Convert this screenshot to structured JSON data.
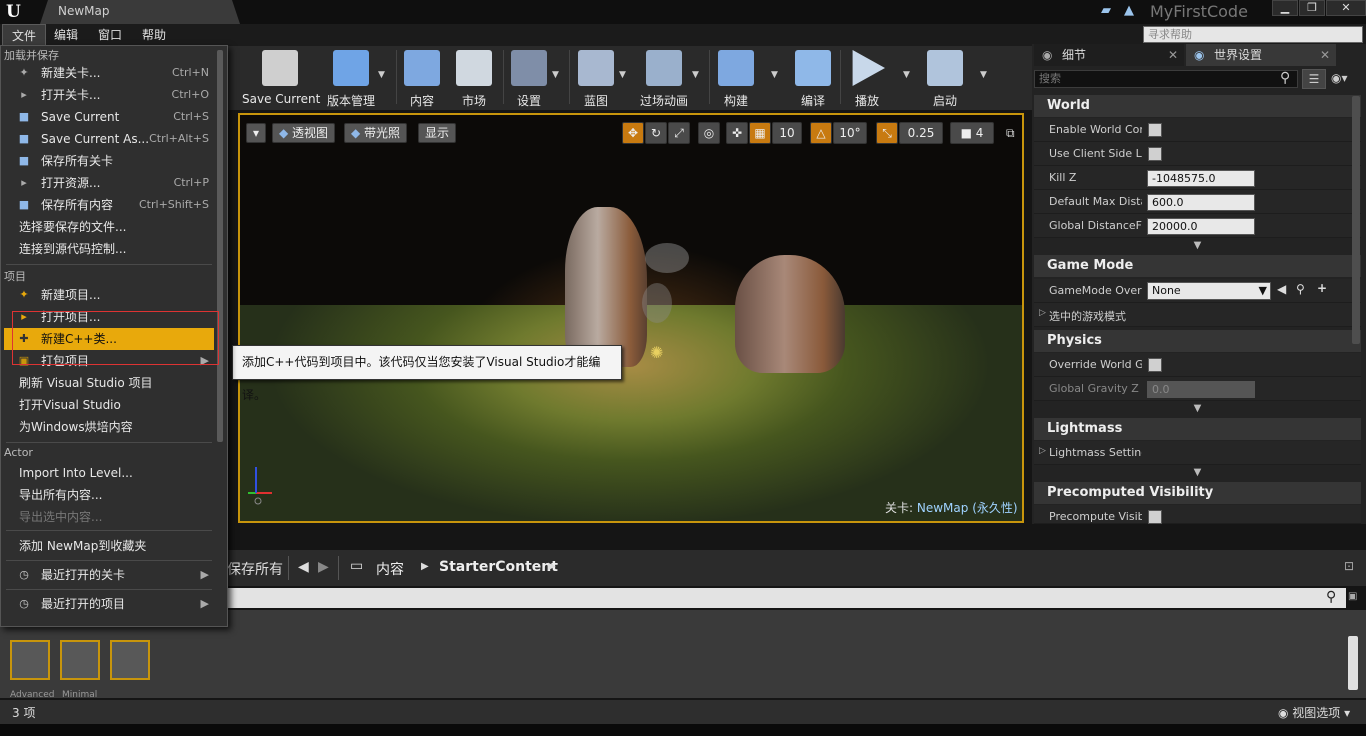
{
  "titlebar": {
    "tab": "NewMap",
    "project": "MyFirstCode",
    "search_placeholder": "寻求帮助"
  },
  "menubar": [
    "文件",
    "编辑",
    "窗口",
    "帮助"
  ],
  "toolbar": [
    {
      "label": "Save Current",
      "icon": "save-icon",
      "color": "#d8d8d8"
    },
    {
      "label": "版本管理",
      "icon": "source-control-icon",
      "color": "#6fa4e6"
    },
    {
      "label": "内容",
      "icon": "content-icon",
      "color": "#7ea8e0"
    },
    {
      "label": "市场",
      "icon": "marketplace-icon",
      "color": "#d0d8e0"
    },
    {
      "label": "设置",
      "icon": "settings-icon",
      "color": "#7f8ea8"
    },
    {
      "label": "蓝图",
      "icon": "blueprint-icon",
      "color": "#a8b8d0"
    },
    {
      "label": "过场动画",
      "icon": "cinematics-icon",
      "color": "#9ab0cc"
    },
    {
      "label": "构建",
      "icon": "build-icon",
      "color": "#7ea8e0"
    },
    {
      "label": "编译",
      "icon": "compile-icon",
      "color": "#8fb8e8"
    },
    {
      "label": "播放",
      "icon": "play-icon",
      "color": "#c8d8ea"
    },
    {
      "label": "启动",
      "icon": "launch-icon",
      "color": "#b0c4dc"
    }
  ],
  "viewport": {
    "buttons": [
      "透视图",
      "带光照",
      "显示"
    ],
    "grid_snap": "10",
    "rot_snap": "10°",
    "scale_snap": "0.25",
    "cam_speed": "4",
    "level_prefix": "关卡:",
    "level_name": "NewMap (永久性)"
  },
  "tooltip": "添加C++代码到项目中。该代码仅当您安装了Visual Studio才能编译。",
  "file_menu": {
    "sections": [
      {
        "header": "加载并保存",
        "items": [
          {
            "label": "新建关卡...",
            "shortcut": "Ctrl+N",
            "icon": "new-level-icon"
          },
          {
            "label": "打开关卡...",
            "shortcut": "Ctrl+O",
            "icon": "open-level-icon"
          },
          {
            "label": "Save Current",
            "shortcut": "Ctrl+S",
            "icon": "save-icon"
          },
          {
            "label": "Save Current As...",
            "shortcut": "Ctrl+Alt+S",
            "icon": "save-as-icon"
          },
          {
            "label": "保存所有关卡",
            "shortcut": "",
            "icon": "save-all-levels-icon"
          },
          {
            "label": "打开资源...",
            "shortcut": "Ctrl+P",
            "icon": "open-asset-icon"
          },
          {
            "label": "保存所有内容",
            "shortcut": "Ctrl+Shift+S",
            "icon": "save-all-icon"
          },
          {
            "label": "选择要保存的文件...",
            "shortcut": "",
            "icon": ""
          },
          {
            "label": "连接到源代码控制...",
            "shortcut": "",
            "icon": ""
          }
        ]
      },
      {
        "header": "项目",
        "items": [
          {
            "label": "新建项目...",
            "shortcut": "",
            "icon": "new-project-icon"
          },
          {
            "label": "打开项目...",
            "shortcut": "",
            "icon": "open-project-icon"
          },
          {
            "label": "新建C++类...",
            "shortcut": "",
            "icon": "new-cpp-class-icon"
          },
          {
            "label": "打包项目",
            "shortcut": "",
            "icon": "package-project-icon"
          },
          {
            "label": "刷新 Visual Studio 项目",
            "shortcut": "",
            "icon": ""
          },
          {
            "label": "打开Visual Studio",
            "shortcut": "",
            "icon": ""
          },
          {
            "label": "为Windows烘培内容",
            "shortcut": "",
            "icon": ""
          }
        ]
      },
      {
        "header": "Actor",
        "items": [
          {
            "label": "Import Into Level...",
            "shortcut": "",
            "icon": ""
          },
          {
            "label": "导出所有内容...",
            "shortcut": "",
            "icon": ""
          },
          {
            "label": "导出选中内容...",
            "shortcut": "",
            "icon": ""
          }
        ]
      }
    ],
    "favorite": "添加 NewMap到收藏夹",
    "recent_levels": "最近打开的关卡",
    "recent_projects": "最近打开的项目"
  },
  "details": {
    "tabs": [
      "细节",
      "世界设置"
    ],
    "search_placeholder": "搜索",
    "sections": {
      "world": "World",
      "game_mode": "Game Mode",
      "physics": "Physics",
      "lightmass": "Lightmass",
      "precomputed": "Precomputed Visibility"
    },
    "props": {
      "enable_world_comp": "Enable World Comp",
      "use_client_side": "Use Client Side Le",
      "kill_z": "Kill Z",
      "kill_z_value": "-1048575.0",
      "max_distance": "Default Max Distar",
      "max_distance_value": "600.0",
      "global_distance": "Global DistanceFie",
      "global_distance_value": "20000.0",
      "gamemode_override": "GameMode Overri",
      "gamemode_value": "None",
      "selected_gamemode": "选中的游戏模式",
      "override_gravity": "Override World Gra",
      "global_gravity": "Global Gravity Z",
      "global_gravity_value": "0.0",
      "lightmass_settings": "Lightmass Setting",
      "precompute_visibility": "Precompute Visibi"
    }
  },
  "content_browser": {
    "save_all": "保存所有",
    "path": [
      "内容",
      "StarterContent"
    ],
    "count": "3 项",
    "view_options": "视图选项",
    "assets": [
      "Advanced",
      "Minimal",
      ""
    ]
  }
}
